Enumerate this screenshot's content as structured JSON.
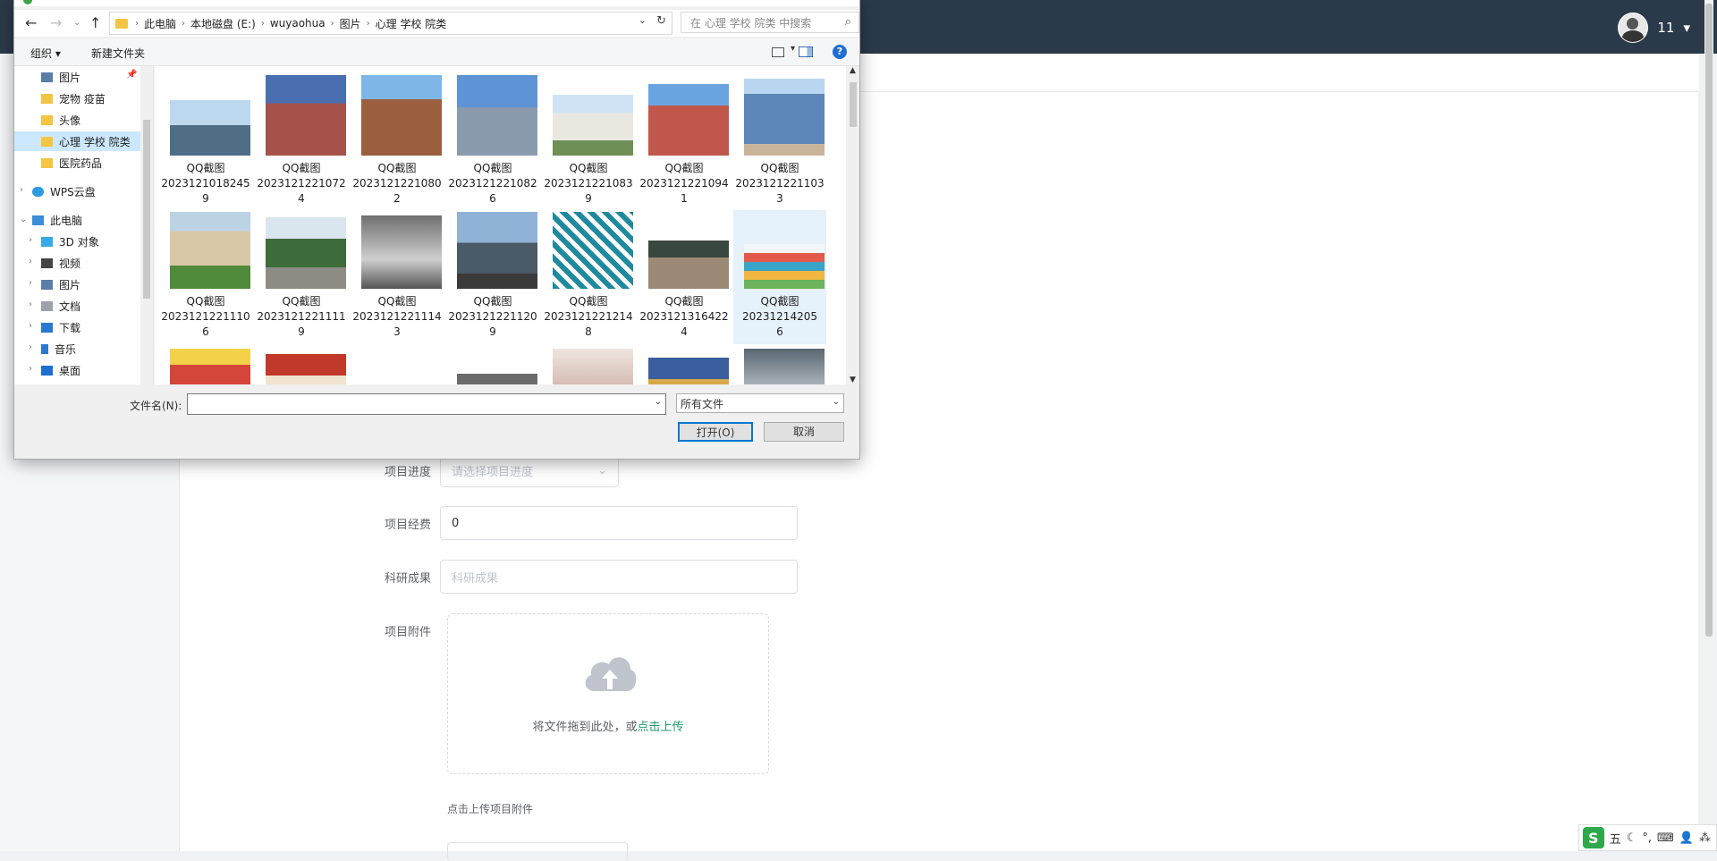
{
  "app": {
    "user": {
      "name": "11"
    }
  },
  "form": {
    "progress_label": "项目进度",
    "progress_placeholder": "请选择项目进度",
    "funds_label": "项目经费",
    "funds_value": "0",
    "result_label": "科研成果",
    "result_placeholder": "科研成果",
    "attachment_label": "项目附件",
    "upload_text": "将文件拖到此处，或",
    "upload_link": "点击上传",
    "upload_hint": "点击上传项目附件"
  },
  "dialog": {
    "address": [
      "此电脑",
      "本地磁盘 (E:)",
      "wuyaohua",
      "图片",
      "心理 学校 院类"
    ],
    "search_placeholder": "在 心理 学校 院类 中搜索",
    "toolbar": {
      "organize": "组织 ▾",
      "new_folder": "新建文件夹"
    },
    "nav_items": [
      {
        "label": "图片",
        "icon": "pictures-icon"
      },
      {
        "label": "宠物  疫苗",
        "icon": "folder-icon"
      },
      {
        "label": "头像",
        "icon": "folder-icon"
      },
      {
        "label": "心理 学校 院类",
        "icon": "folder-icon",
        "selected": true
      },
      {
        "label": "医院药品",
        "icon": "folder-icon"
      },
      {
        "label": "WPS云盘",
        "icon": "cloud-icon"
      },
      {
        "label": "此电脑",
        "icon": "computer-icon"
      },
      {
        "label": "3D 对象",
        "icon": "cube-icon"
      },
      {
        "label": "视频",
        "icon": "video-icon"
      },
      {
        "label": "图片",
        "icon": "pictures-icon"
      },
      {
        "label": "文档",
        "icon": "document-icon"
      },
      {
        "label": "下载",
        "icon": "download-icon"
      },
      {
        "label": "音乐",
        "icon": "music-icon"
      },
      {
        "label": "桌面",
        "icon": "desktop-icon"
      }
    ],
    "files_row1": [
      {
        "line1": "QQ截图",
        "line2": "2023121018245",
        "line3": "9"
      },
      {
        "line1": "QQ截图",
        "line2": "2023121221072",
        "line3": "4"
      },
      {
        "line1": "QQ截图",
        "line2": "2023121221080",
        "line3": "2"
      },
      {
        "line1": "QQ截图",
        "line2": "2023121221082",
        "line3": "6"
      },
      {
        "line1": "QQ截图",
        "line2": "2023121221083",
        "line3": "9"
      },
      {
        "line1": "QQ截图",
        "line2": "2023121221094",
        "line3": "1"
      },
      {
        "line1": "QQ截图",
        "line2": "2023121221103",
        "line3": "3"
      }
    ],
    "files_row2": [
      {
        "line1": "QQ截图",
        "line2": "2023121221110",
        "line3": "6"
      },
      {
        "line1": "QQ截图",
        "line2": "2023121221111",
        "line3": "9"
      },
      {
        "line1": "QQ截图",
        "line2": "2023121221114",
        "line3": "3"
      },
      {
        "line1": "QQ截图",
        "line2": "2023121221120",
        "line3": "9"
      },
      {
        "line1": "QQ截图",
        "line2": "2023121221214",
        "line3": "8"
      },
      {
        "line1": "QQ截图",
        "line2": "2023121316422",
        "line3": "4"
      },
      {
        "line1": "QQ截图",
        "line2": "20231214205",
        "line3": "6"
      }
    ],
    "filename_label": "文件名(N):",
    "filename_value": "",
    "filetype": "所有文件",
    "open_button": "打开(O)",
    "cancel_button": "取消"
  },
  "ime": {
    "items": [
      "五",
      "☾",
      "°,",
      "⌨",
      "👤",
      "⁂"
    ]
  }
}
